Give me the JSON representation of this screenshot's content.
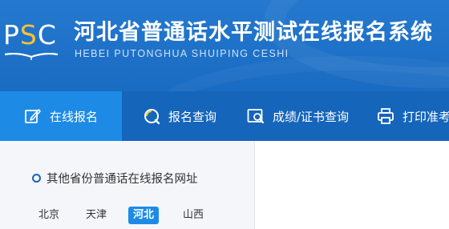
{
  "header": {
    "logo_text": "PSC",
    "title": "河北省普通话水平测试在线报名系统",
    "subtitle": "HEBEI PUTONGHUA SHUIPING CESHI"
  },
  "nav": {
    "items": [
      {
        "label": "在线报名",
        "icon": "edit-icon",
        "active": true
      },
      {
        "label": "报名查询",
        "icon": "search-icon",
        "active": false
      },
      {
        "label": "成绩/证书查询",
        "icon": "certificate-search-icon",
        "active": false
      },
      {
        "label": "打印准考证",
        "icon": "printer-icon",
        "active": false
      }
    ]
  },
  "sidebar": {
    "title": "其他省份普通话在线报名网址",
    "provinces": [
      {
        "label": "北京",
        "active": false
      },
      {
        "label": "天津",
        "active": false
      },
      {
        "label": "河北",
        "active": true
      },
      {
        "label": "山西",
        "active": false
      }
    ]
  },
  "colors": {
    "header_bg": "#1f72c8",
    "nav_bg": "#1565bb",
    "nav_active_bg": "#1d8be6",
    "logo_accent": "#f6c232",
    "sidebar_bg": "#f4f6f9"
  }
}
